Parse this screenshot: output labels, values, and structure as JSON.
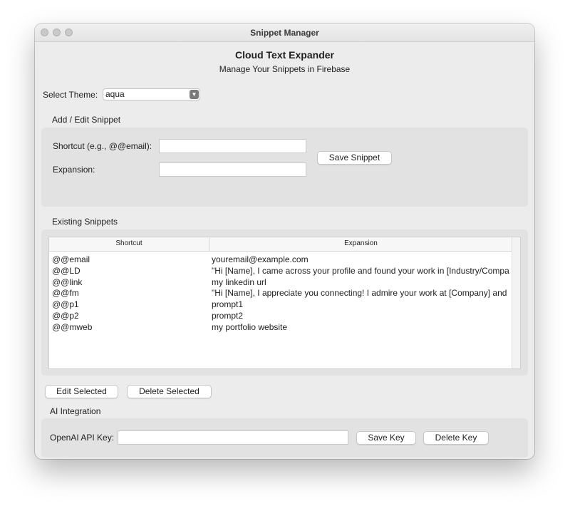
{
  "window": {
    "title": "Snippet Manager"
  },
  "header": {
    "title": "Cloud Text Expander",
    "subtitle": "Manage Your Snippets in Firebase"
  },
  "theme": {
    "label": "Select Theme:",
    "selected": "aqua"
  },
  "edit_group": {
    "title": "Add / Edit Snippet",
    "shortcut_label": "Shortcut (e.g., @@email):",
    "shortcut_value": "",
    "expansion_label": "Expansion:",
    "expansion_value": "",
    "save_label": "Save Snippet"
  },
  "snippets": {
    "title": "Existing Snippets",
    "columns": [
      "Shortcut",
      "Expansion"
    ],
    "rows": [
      {
        "shortcut": "@@email",
        "expansion": "youremail@example.com"
      },
      {
        "shortcut": "@@LD",
        "expansion": "\"Hi [Name], I came across your profile and found your work in [Industry/Compa"
      },
      {
        "shortcut": "@@link",
        "expansion": "my linkedin url"
      },
      {
        "shortcut": "@@fm",
        "expansion": "\"Hi [Name], I appreciate you connecting! I admire your work at [Company] and"
      },
      {
        "shortcut": "@@p1",
        "expansion": "prompt1"
      },
      {
        "shortcut": "@@p2",
        "expansion": "prompt2"
      },
      {
        "shortcut": "@@mweb",
        "expansion": "my portfolio website"
      }
    ]
  },
  "actions": {
    "edit_label": "Edit Selected",
    "delete_label": "Delete Selected"
  },
  "ai": {
    "title": "AI Integration",
    "key_label": "OpenAI API Key:",
    "key_value": "",
    "save_label": "Save Key",
    "delete_label": "Delete Key"
  }
}
